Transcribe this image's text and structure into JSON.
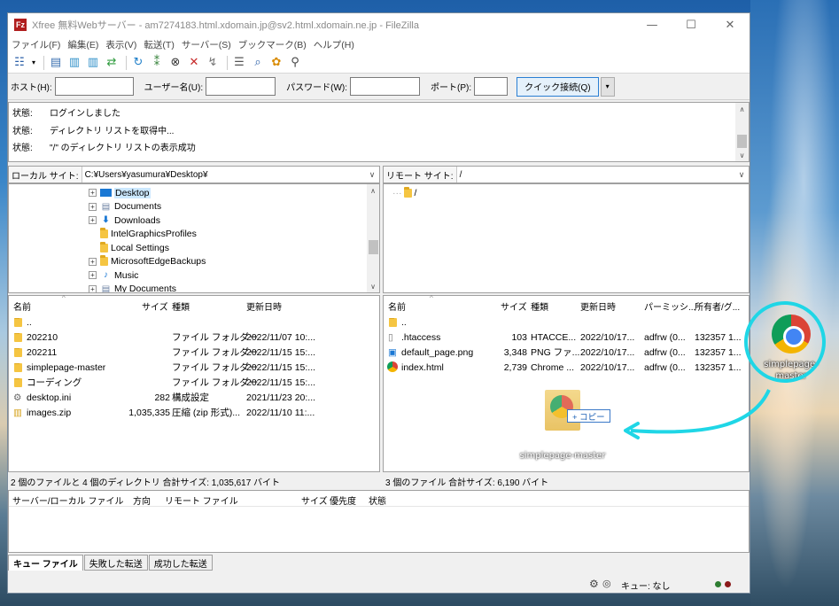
{
  "window": {
    "app_icon_glyph": "Fz",
    "title": "Xfree 無料Webサーバー - am7274183.html.xdomain.jp@sv2.html.xdomain.ne.jp - FileZilla",
    "minimize": "—",
    "maximize": "☐",
    "close": "✕"
  },
  "menu": [
    "ファイル(F)",
    "編集(E)",
    "表示(V)",
    "転送(T)",
    "サーバー(S)",
    "ブックマーク(B)",
    "ヘルプ(H)"
  ],
  "toolbar_icons": [
    "site-manager-icon",
    "dropdown-icon",
    "toggle-log-icon",
    "toggle-local-tree-icon",
    "toggle-remote-tree-icon",
    "toggle-queue-icon",
    "refresh-icon",
    "process-queue-icon",
    "cancel-icon",
    "disconnect-icon",
    "reconnect-icon",
    "compare-icon",
    "filter-icon",
    "search-icon",
    "sync-browse-icon",
    "binoculars-icon"
  ],
  "quickconnect": {
    "host_label": "ホスト(H):",
    "host_value": "",
    "user_label": "ユーザー名(U):",
    "user_value": "",
    "pass_label": "パスワード(W):",
    "pass_value": "",
    "port_label": "ポート(P):",
    "port_value": "",
    "connect_button": "クイック接続(Q)",
    "dropdown": "▾"
  },
  "log": [
    {
      "key": "状態:",
      "msg": "ログインしました"
    },
    {
      "key": "状態:",
      "msg": "ディレクトリ リストを取得中..."
    },
    {
      "key": "状態:",
      "msg": "\"/\" のディレクトリ リストの表示成功"
    }
  ],
  "local": {
    "site_label": "ローカル サイト:",
    "path": "C:¥Users¥yasumura¥Desktop¥",
    "tree": [
      {
        "label": "Desktop",
        "expander": "+",
        "selected": true
      },
      {
        "label": "Documents",
        "expander": "+"
      },
      {
        "label": "Downloads",
        "expander": "+"
      },
      {
        "label": "IntelGraphicsProfiles",
        "expander": ""
      },
      {
        "label": "Local Settings",
        "expander": ""
      },
      {
        "label": "MicrosoftEdgeBackups",
        "expander": "+"
      },
      {
        "label": "Music",
        "expander": "+"
      },
      {
        "label": "My Documents",
        "expander": "+"
      }
    ],
    "columns": {
      "name": "名前",
      "size": "サイズ",
      "type": "種類",
      "modified": "更新日時"
    },
    "files": [
      {
        "name": "..",
        "size": "",
        "type": "",
        "modified": ""
      },
      {
        "name": "202210",
        "size": "",
        "type": "ファイル フォルダー",
        "modified": "2022/11/07 10:..."
      },
      {
        "name": "202211",
        "size": "",
        "type": "ファイル フォルダー",
        "modified": "2022/11/15 15:..."
      },
      {
        "name": "simplepage-master",
        "size": "",
        "type": "ファイル フォルダー",
        "modified": "2022/11/15 15:..."
      },
      {
        "name": "コーディング",
        "size": "",
        "type": "ファイル フォルダー",
        "modified": "2022/11/15 15:..."
      },
      {
        "name": "desktop.ini",
        "size": "282",
        "type": "構成設定",
        "modified": "2021/11/23 20:..."
      },
      {
        "name": "images.zip",
        "size": "1,035,335",
        "type": "圧縮 (zip 形式)...",
        "modified": "2022/11/10 11:..."
      }
    ],
    "status": "2 個のファイルと 4 個のディレクトリ 合計サイズ: 1,035,617 バイト"
  },
  "remote": {
    "site_label": "リモート サイト:",
    "path": "/",
    "tree_root": "/",
    "columns": {
      "name": "名前",
      "size": "サイズ",
      "type": "種類",
      "modified": "更新日時",
      "perm": "パーミッシ...",
      "owner": "所有者/グ..."
    },
    "files": [
      {
        "name": "..",
        "size": "",
        "type": "",
        "modified": "",
        "perm": "",
        "owner": ""
      },
      {
        "name": ".htaccess",
        "size": "103",
        "type": "HTACCE...",
        "modified": "2022/10/17...",
        "perm": "adfrw (0...",
        "owner": "132357 1..."
      },
      {
        "name": "default_page.png",
        "size": "3,348",
        "type": "PNG ファ...",
        "modified": "2022/10/17...",
        "perm": "adfrw (0...",
        "owner": "132357 1..."
      },
      {
        "name": "index.html",
        "size": "2,739",
        "type": "Chrome ...",
        "modified": "2022/10/17...",
        "perm": "adfrw (0...",
        "owner": "132357 1..."
      }
    ],
    "status": "3 個のファイル 合計サイズ: 6,190 バイト"
  },
  "drag": {
    "copy_label": "+ コピー",
    "label": "simplepage-master"
  },
  "queue": {
    "columns": [
      "サーバー/ローカル ファイル",
      "方向",
      "リモート ファイル",
      "サイズ",
      "優先度",
      "状態"
    ],
    "tabs": [
      "キュー ファイル",
      "失敗した転送",
      "成功した転送"
    ]
  },
  "statusbar": {
    "queue_text": "キュー: なし"
  },
  "desktop": {
    "icon_label": "simplepage-master"
  },
  "colors": {
    "accent": "#2a7fd4",
    "annotation": "#1fd6e6"
  }
}
